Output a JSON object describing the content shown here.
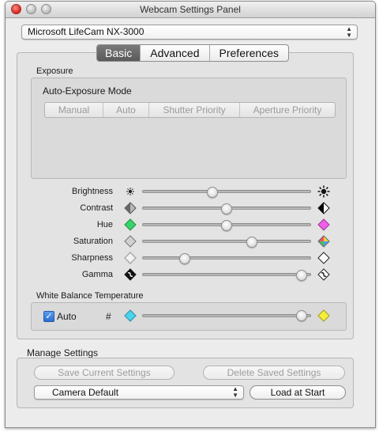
{
  "window": {
    "title": "Webcam Settings Panel"
  },
  "camera_select": {
    "value": "Microsoft LifeCam NX-3000"
  },
  "tabs": [
    {
      "label": "Basic",
      "selected": true
    },
    {
      "label": "Advanced",
      "selected": false
    },
    {
      "label": "Preferences",
      "selected": false
    }
  ],
  "exposure": {
    "section_label": "Exposure",
    "mode_label": "Auto-Exposure Mode",
    "modes": [
      "Manual",
      "Auto",
      "Shutter Priority",
      "Aperture Priority"
    ]
  },
  "controls": [
    {
      "label": "Brightness",
      "min_icon": "sun-small-icon",
      "max_icon": "sun-large-icon",
      "value": 0.41
    },
    {
      "label": "Contrast",
      "min_icon": "contrast-low-icon",
      "max_icon": "contrast-high-icon",
      "value": 0.5
    },
    {
      "label": "Hue",
      "min_icon": "hue-green-icon",
      "max_icon": "hue-magenta-icon",
      "value": 0.5
    },
    {
      "label": "Saturation",
      "min_icon": "saturation-low-icon",
      "max_icon": "saturation-high-icon",
      "value": 0.66
    },
    {
      "label": "Sharpness",
      "min_icon": "sharpness-low-icon",
      "max_icon": "sharpness-high-icon",
      "value": 0.24
    },
    {
      "label": "Gamma",
      "min_icon": "gamma-low-icon",
      "max_icon": "gamma-high-icon",
      "value": 0.97
    }
  ],
  "white_balance": {
    "section_label": "White Balance Temperature",
    "auto_label": "Auto",
    "auto_checked": true,
    "value_symbol": "#",
    "value": 0.97,
    "min_icon": "wb-cool-icon",
    "max_icon": "wb-warm-icon"
  },
  "manage": {
    "section_label": "Manage Settings",
    "save_label": "Save Current Settings",
    "delete_label": "Delete Saved Settings",
    "preset_value": "Camera Default",
    "load_label": "Load at Start"
  }
}
